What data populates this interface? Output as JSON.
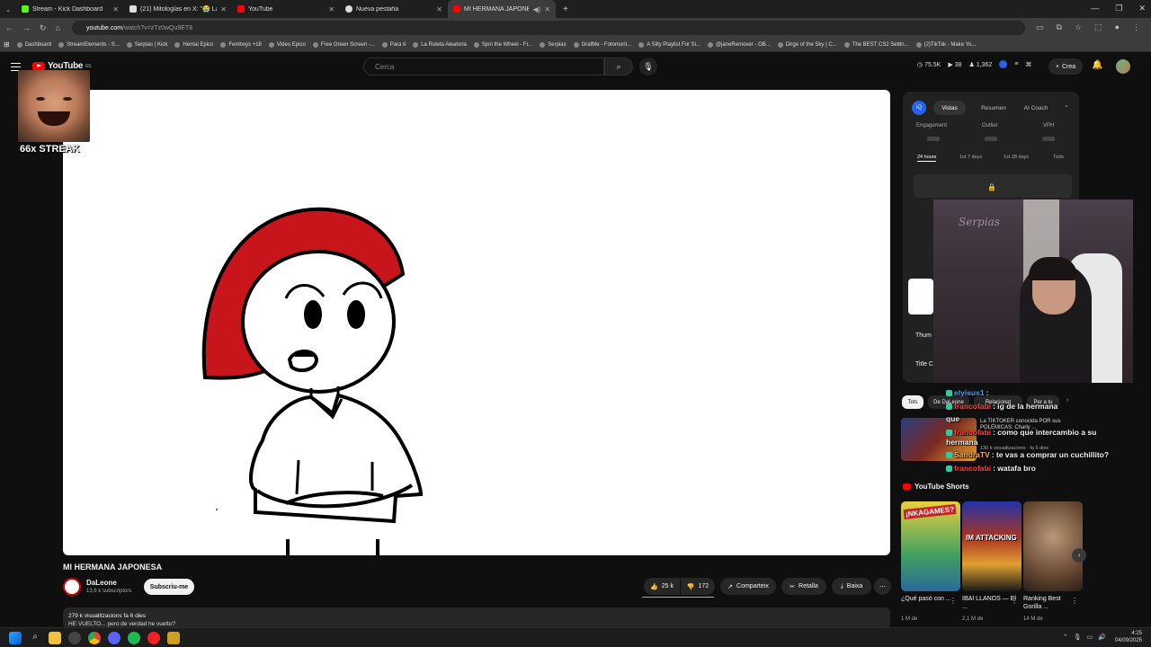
{
  "browser": {
    "tabs": [
      {
        "label": "Stream - Kick Dashboard",
        "color": "#53fc18"
      },
      {
        "label": "(21) Mitologías en X: \"😭 La c",
        "color": "#dddddd"
      },
      {
        "label": "YouTube",
        "color": "#ff0000"
      },
      {
        "label": "Nueva pestaña",
        "color": "#dddddd"
      },
      {
        "label": "MI HERMANA JAPONESA -",
        "color": "#ff0000"
      }
    ],
    "url": "youtube.com",
    "url_path": "/watch?v=zTz0wQu9ET8",
    "bookmarks": [
      "Dashboard",
      "StreamElements - S...",
      "Serpias | Kick",
      "Hentai Epico",
      "Femboys +18",
      "Video Epico",
      "Free Green Screen -...",
      "Para ti",
      "La Ruleta Aleatoria",
      "Spin the Wheel - Fr...",
      "Serpias",
      "GrafMe - Fotomont...",
      "A Silly Playlist For Si...",
      "@janeRemover - OB...",
      "Dirge of the Sky | C...",
      "The BEST CS2 Settin...",
      "(2)TikTok - Make Yo..."
    ]
  },
  "youtube": {
    "logo": "YouTube",
    "logo_sup": "ES",
    "search_placeholder": "Cerca",
    "stats": [
      "75.5K",
      "38",
      "1,362"
    ],
    "create_label": "Crea"
  },
  "overlay": {
    "streak": "66x STREAK"
  },
  "video": {
    "title": "MI HERMANA JAPONESA",
    "channel": "DaLeone",
    "subscribers": "13,6 k subscriptors",
    "subscribe_label": "Subscriu-me",
    "likes": "25 k",
    "dislikes": "172",
    "share_label": "Comparteix",
    "clip_label": "Retalla",
    "download_label": "Baixa",
    "views_line": "279 k visualitzacions  fa 6 dies",
    "desc_line": "HE VUELTO... pero de verdad he vuelto?"
  },
  "vidiq": {
    "logo": "iQ",
    "tabs": [
      "Vistas",
      "Resumen",
      "AI Coach"
    ],
    "labels": [
      "Engagement",
      "Outlier",
      "VPH"
    ],
    "ranges": [
      "24 hours",
      "1st 7 days",
      "1st 28 days",
      "Todo"
    ],
    "thumb_label": "Thum",
    "title_label": "Title C"
  },
  "webcam_sign": "Serpias",
  "chips": [
    "Tots",
    "De DaLeone",
    "Relacionat",
    "Per a tu"
  ],
  "rec1": {
    "title": "La TIKTOKER conocida POR sus POLÉMICAS: Charly ...",
    "meta": "130 k visualitzacions · fa 6 dies"
  },
  "shorts": {
    "heading": "YouTube Shorts",
    "items": [
      {
        "title": "¿Qué pasó con ...",
        "views": "1 M de",
        "overlay": "¡NKAGAMES?"
      },
      {
        "title": "IBAI LLANOS — El ...",
        "views": "2,1 M de",
        "overlay": "IM ATTACKING"
      },
      {
        "title": "Ranking Best Gorilla ...",
        "views": "14 M de",
        "overlay": ""
      }
    ]
  },
  "chat": [
    {
      "user": "elyisus1",
      "color": "#4aa3ff",
      "msg": ":"
    },
    {
      "user": "francofabi",
      "color": "#ff4040",
      "msg": ": ig de la hermana"
    },
    {
      "user": "",
      "color": "#ff4040",
      "msg": "que"
    },
    {
      "user": "francofabi",
      "color": "#ff4040",
      "msg": ": como que intercambio a su hermana"
    },
    {
      "user": "SandraTV",
      "color": "#ffb13b",
      "msg": ": te vas a comprar un cuchillito?"
    },
    {
      "user": "francofabi",
      "color": "#ff4040",
      "msg": ": watafa bro"
    }
  ],
  "clock": {
    "time": "4:25",
    "date": "04/09/2025"
  }
}
